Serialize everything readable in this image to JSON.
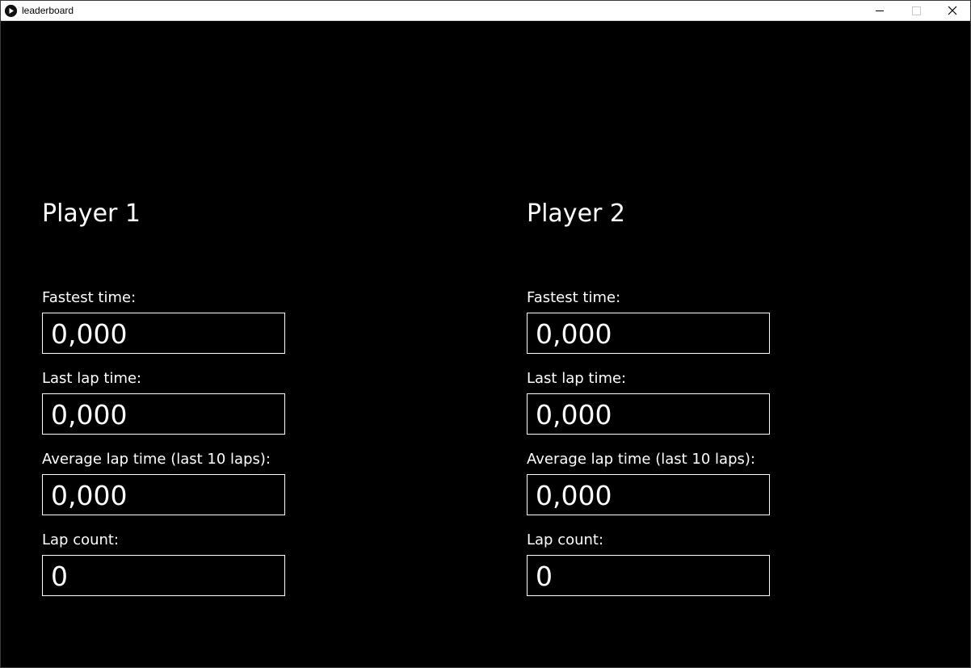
{
  "window": {
    "title": "leaderboard",
    "icon": "play-circle-icon"
  },
  "players": [
    {
      "title": "Player 1",
      "stats": [
        {
          "label": "Fastest time:",
          "value": "0,000"
        },
        {
          "label": "Last lap time:",
          "value": "0,000"
        },
        {
          "label": "Average lap time (last 10 laps):",
          "value": "0,000"
        },
        {
          "label": "Lap count:",
          "value": "0"
        }
      ]
    },
    {
      "title": "Player 2",
      "stats": [
        {
          "label": "Fastest time:",
          "value": "0,000"
        },
        {
          "label": "Last lap time:",
          "value": "0,000"
        },
        {
          "label": "Average lap time (last 10 laps):",
          "value": "0,000"
        },
        {
          "label": "Lap count:",
          "value": "0"
        }
      ]
    }
  ],
  "colors": {
    "background": "#000000",
    "text": "#ffffff",
    "titlebar": "#ffffff"
  }
}
